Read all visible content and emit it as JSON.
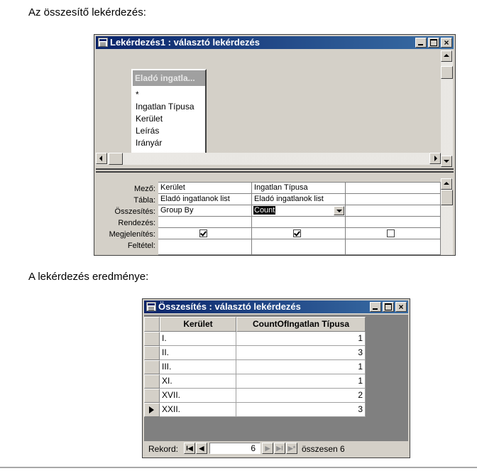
{
  "captions": {
    "design_heading": "Az összesítő lekérdezés:",
    "result_heading": "A lekérdezés eredménye:"
  },
  "design_window": {
    "title": "Lekérdezés1 : választó lekérdezés",
    "field_list": {
      "title": "Eladó ingatla...",
      "items": [
        "*",
        "Ingatlan Típusa",
        "Kerület",
        "Leírás",
        "Irányár"
      ]
    },
    "grid": {
      "row_labels": {
        "field": "Mező:",
        "table": "Tábla:",
        "total": "Összesítés:",
        "sort": "Rendezés:",
        "show": "Megjelenítés:",
        "criteria": "Feltétel:"
      },
      "columns": [
        {
          "field": "Kerület",
          "table": "Eladó ingatlanok list",
          "total": "Group By",
          "show": true
        },
        {
          "field": "Ingatlan Típusa",
          "table": "Eladó ingatlanok list",
          "total": "Count",
          "show": true
        },
        {
          "field": "",
          "table": "",
          "total": "",
          "show": false
        }
      ]
    }
  },
  "result_window": {
    "title": "Összesítés : választó lekérdezés",
    "headers": [
      "Kerület",
      "CountOfIngatlan Típusa"
    ],
    "rows": [
      [
        "I.",
        "1"
      ],
      [
        "II.",
        "3"
      ],
      [
        "III.",
        "1"
      ],
      [
        "XI.",
        "1"
      ],
      [
        "XVII.",
        "2"
      ],
      [
        "XXII.",
        "3"
      ]
    ],
    "current_row": 5,
    "navigation": {
      "record_label": "Rekord:",
      "current": "6",
      "total_label": "összesen",
      "total": "6"
    }
  }
}
